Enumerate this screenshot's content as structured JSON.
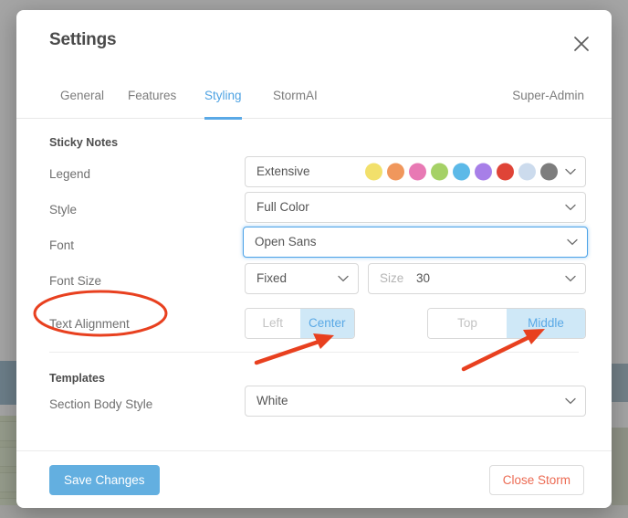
{
  "modal": {
    "title": "Settings",
    "close_icon": "close-icon"
  },
  "tabs": {
    "items": [
      {
        "label": "General",
        "active": false
      },
      {
        "label": "Features",
        "active": false
      },
      {
        "label": "Styling",
        "active": true
      },
      {
        "label": "StormAI",
        "active": false
      }
    ],
    "role_label": "Super-Admin"
  },
  "sections": {
    "sticky_notes": {
      "heading": "Sticky Notes",
      "legend": {
        "label": "Legend",
        "value": "Extensive",
        "chevron_icon": "chevron-down-icon",
        "swatches": [
          "#f2e06b",
          "#f0975c",
          "#e879b4",
          "#a5d166",
          "#5cb9e8",
          "#a77fe8",
          "#df4437",
          "#ccdbed",
          "#7d7d7d"
        ]
      },
      "style": {
        "label": "Style",
        "value": "Full Color",
        "chevron_icon": "chevron-down-icon"
      },
      "font": {
        "label": "Font",
        "value": "Open Sans",
        "chevron_icon": "chevron-down-icon",
        "focused": true
      },
      "font_size": {
        "label": "Font Size",
        "mode_value": "Fixed",
        "mode_chevron_icon": "chevron-down-icon",
        "size_placeholder": "Size",
        "size_value": "30",
        "size_chevron_icon": "chevron-down-icon"
      },
      "text_alignment": {
        "label": "Text Alignment",
        "horizontal": [
          {
            "label": "Left",
            "selected": false
          },
          {
            "label": "Center",
            "selected": true
          }
        ],
        "vertical": [
          {
            "label": "Top",
            "selected": false
          },
          {
            "label": "Middle",
            "selected": true
          }
        ]
      }
    },
    "templates": {
      "heading": "Templates",
      "section_body_style": {
        "label": "Section Body Style",
        "value": "White",
        "chevron_icon": "chevron-down-icon"
      }
    }
  },
  "footer": {
    "save_label": "Save Changes",
    "close_storm_label": "Close Storm"
  },
  "annotations": {
    "accent_color": "#e8401f",
    "ellipse_target": "text-alignment-label",
    "arrow_1_target": "center-toggle",
    "arrow_2_target": "middle-toggle"
  }
}
